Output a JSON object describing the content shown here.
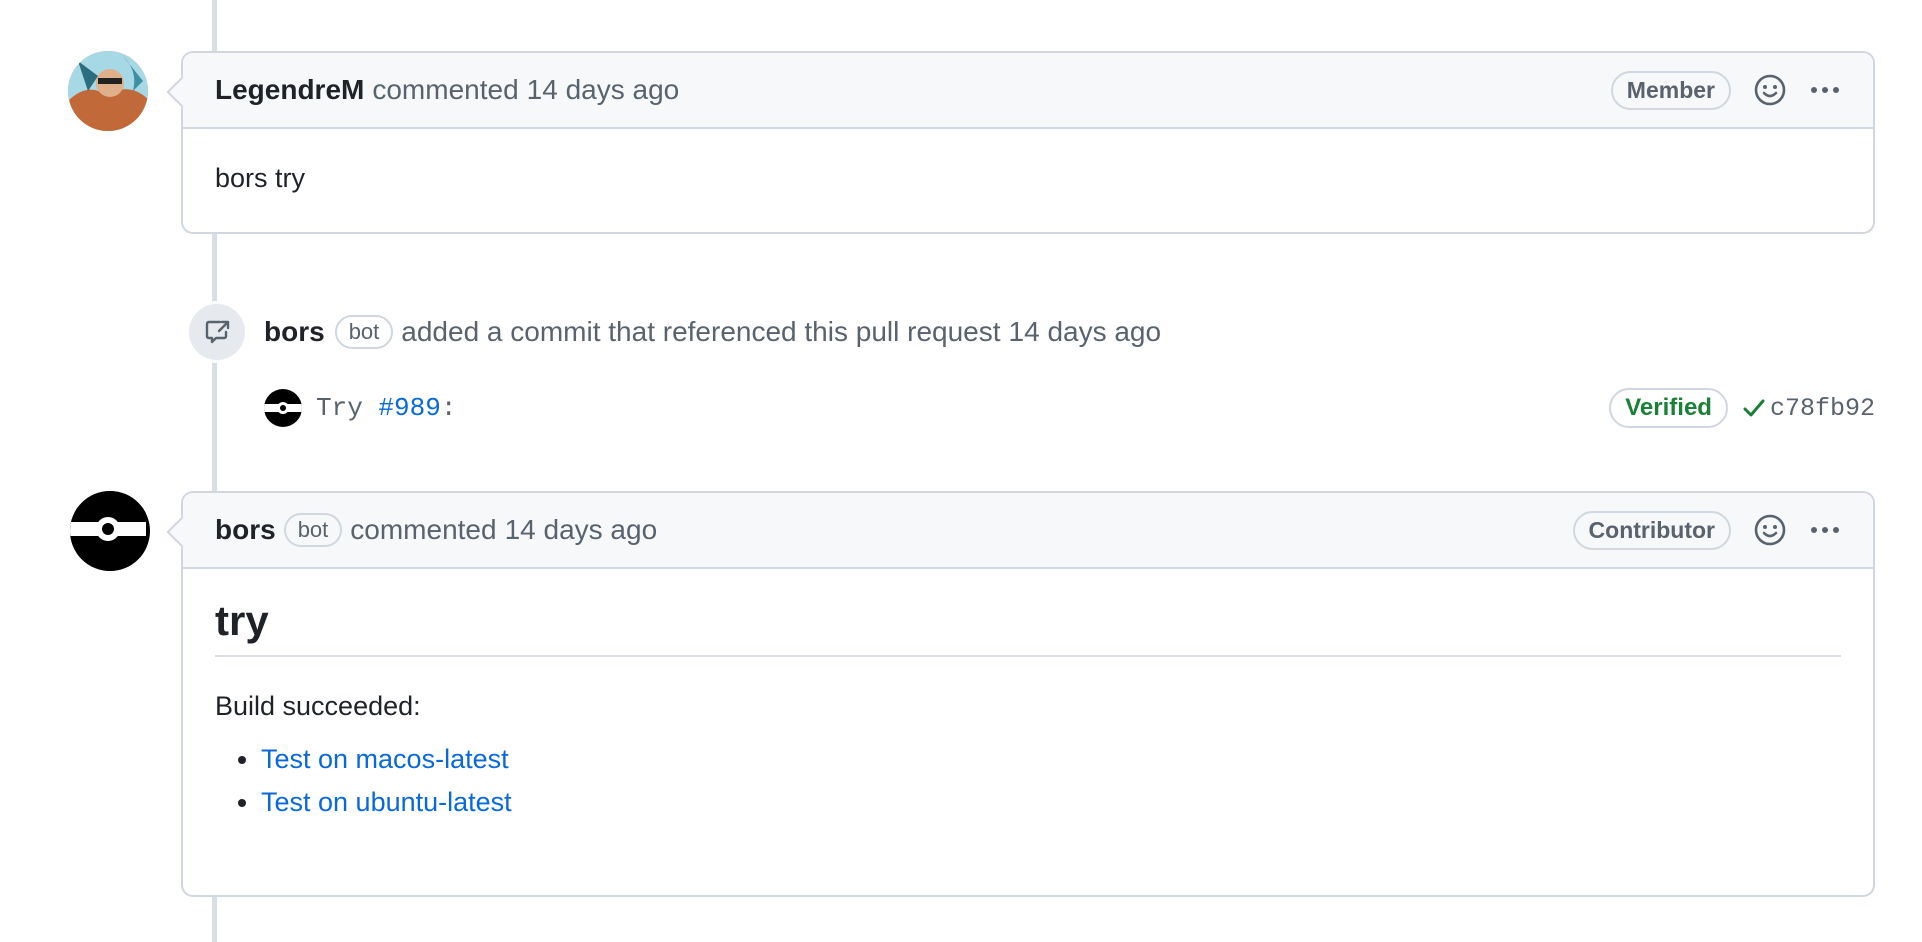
{
  "comment1": {
    "author": "LegendreM",
    "action": "commented",
    "time": "14 days ago",
    "role_badge": "Member",
    "body": "bors try",
    "icons": {
      "reaction": "smiley-icon",
      "menu": "kebab-menu-icon"
    }
  },
  "event": {
    "author": "bors",
    "bot_label": "bot",
    "action": "added a commit that referenced this pull request",
    "time": "14 days ago",
    "icon": "cross-reference-icon"
  },
  "commit": {
    "prefix": "Try",
    "link": "#989",
    "suffix": ":",
    "verified": "Verified",
    "sha": "c78fb92",
    "verified_color": "#1a7f37"
  },
  "comment2": {
    "author": "bors",
    "bot_label": "bot",
    "action": "commented",
    "time": "14 days ago",
    "role_badge": "Contributor",
    "heading": "try",
    "text": "Build succeeded:",
    "links": [
      {
        "label": "Test on macos-latest"
      },
      {
        "label": "Test on ubuntu-latest"
      }
    ],
    "icons": {
      "reaction": "smiley-icon",
      "menu": "kebab-menu-icon"
    }
  },
  "colors": {
    "link": "#0969da",
    "muted": "#59636e",
    "border": "#d0d7de",
    "header_bg": "#f6f8fa"
  }
}
